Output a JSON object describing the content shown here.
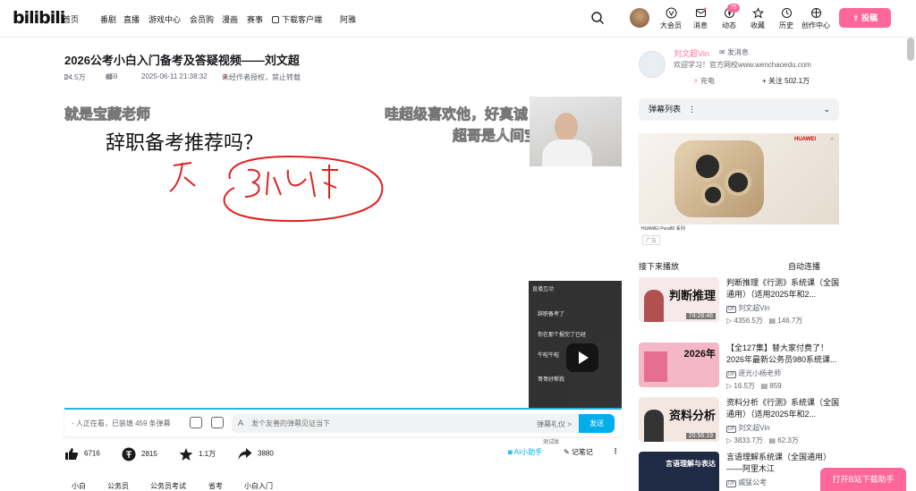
{
  "topbar": {
    "logo": "bilibili",
    "nav": [
      "首页",
      "番剧",
      "直播",
      "游戏中心",
      "会员购",
      "漫画",
      "赛事",
      "下载客户端",
      "阿雅"
    ],
    "icons": [
      {
        "label": "大会员",
        "icon": "vip-icon"
      },
      {
        "label": "消息",
        "icon": "message-icon"
      },
      {
        "label": "动态",
        "icon": "activity-icon"
      },
      {
        "label": "收藏",
        "icon": "favorite-icon"
      },
      {
        "label": "历史",
        "icon": "history-icon"
      },
      {
        "label": "创作中心",
        "icon": "creator-icon"
      }
    ],
    "dynamic_badge": "75",
    "upload": "投稿"
  },
  "video": {
    "title": "2026公考小白入门备考及答疑视频——刘文超",
    "views": "24.5万",
    "danmaku_count": "459",
    "date": "2025-06-11 21:38:32",
    "notice": "未经作者授权，禁止转载"
  },
  "player": {
    "danmu": [
      "就是宝藏老师",
      "哇超级喜欢他，好真诚",
      "超哥是人间宝藏"
    ],
    "board_text": "辞职备考推荐吗？",
    "chat_header": "直播互动",
    "chat": [
      "辞职备考了",
      "你在那个报完了已经",
      "牛啦牛啦",
      "哥哥好帮我"
    ]
  },
  "sendbar": {
    "status": "- 人正在看，已装填 459 条弹幕",
    "placeholder": "发个友善的弹幕见证当下",
    "etiquette": "弹幕礼仪 >",
    "send": "发送",
    "test": "测试版"
  },
  "actions": {
    "like": "6716",
    "coin": "2815",
    "favorite": "1.1万",
    "share": "3880",
    "ai": "AI小助手",
    "notes": "记笔记"
  },
  "tags": [
    "小白",
    "公务员",
    "公务员考试",
    "省考",
    "小白入门"
  ],
  "uploader": {
    "name": "刘文超Vin",
    "message": "发消息",
    "desc": "欢迎学习！官方网校www.wenchaoedu.com",
    "charge": "充电",
    "follow": "+ 关注 502.1万"
  },
  "sidebar": {
    "danmaku_list": "弹幕列表",
    "ad_tag": "广告",
    "ad_brand": "HUAWEI",
    "ad_caption": "HUAWEI Pura80 系列",
    "next_header": "接下来播放",
    "autoplay": "自动连播",
    "videos": [
      {
        "title": "判断推理《行测》系统课（全国通用）（适用2025年和2...",
        "up": "刘文超Vin",
        "views": "4356.5万",
        "danmaku": "146.7万",
        "duration": "74:28:48",
        "thumb_text": "判断推理",
        "bg": "#f6e9ea"
      },
      {
        "title": "【全127集】替大家付费了！2026年最新公务员980系统课...",
        "up": "逐光小杨老师",
        "views": "16.5万",
        "danmaku": "859",
        "duration": "",
        "thumb_text": "2026年",
        "bg": "#f4b7c6"
      },
      {
        "title": "资料分析《行测》系统课（全国通用）（适用2025年和2...",
        "up": "刘文超Vin",
        "views": "3833.7万",
        "danmaku": "62.3万",
        "duration": "20:56:19",
        "thumb_text": "资料分析",
        "bg": "#f3e7e2"
      },
      {
        "title": "言语理解系统课（全国通用）——阿里木江",
        "up": "威猛公考",
        "views": "",
        "danmaku": "",
        "duration": "",
        "thumb_text": "言语理解与表达",
        "bg": "#1f2a44"
      }
    ],
    "cta": "打开B站下载助手"
  }
}
